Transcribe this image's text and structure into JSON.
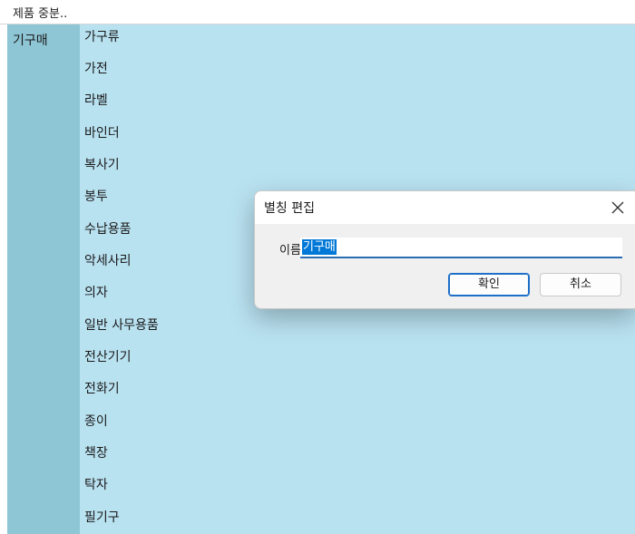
{
  "table": {
    "header": "제품 중분..",
    "category": "기구매",
    "subcategories": [
      "가구류",
      "가전",
      "라벨",
      "바인더",
      "복사기",
      "봉투",
      "수납용품",
      "악세사리",
      "의자",
      "일반 사무용품",
      "전산기기",
      "전화기",
      "종이",
      "책장",
      "탁자",
      "필기구"
    ]
  },
  "dialog": {
    "title": "별칭 편집",
    "name_label": "이름:",
    "name_value": "기구매",
    "ok_label": "확인",
    "cancel_label": "취소",
    "close_icon": "close-icon"
  },
  "colors": {
    "category_column": "#8fc6d6",
    "subcategory_column": "#b9e2f1",
    "selection": "#0078d7",
    "accent": "#1e6fc7"
  }
}
